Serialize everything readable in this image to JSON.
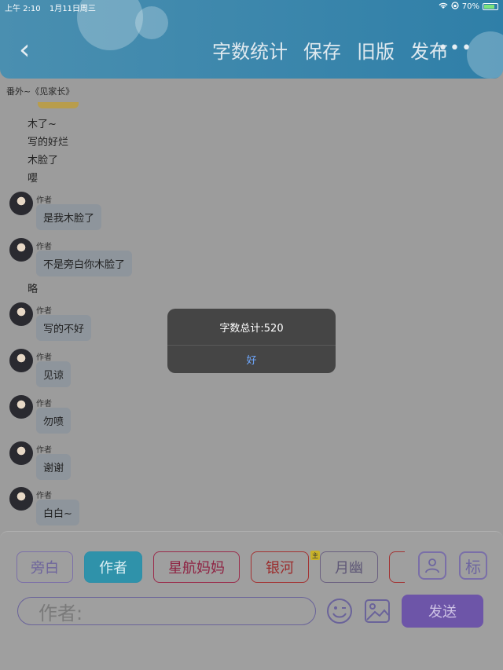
{
  "status": {
    "time": "上午 2:10",
    "date": "1月11日周三",
    "battery": "70%"
  },
  "header": {
    "back_icon": "chevron-left-icon",
    "nav": [
      "字数统计",
      "保存",
      "旧版",
      "发布"
    ],
    "more": "•••"
  },
  "subtitle": "番外~《见家长》",
  "plain_lines": [
    "木了~",
    "写的好烂",
    "木脸了",
    "嘤",
    "略"
  ],
  "messages": [
    {
      "name": "作者",
      "text": "是我木脸了"
    },
    {
      "name": "作者",
      "text": "不是旁白你木脸了"
    },
    {
      "name": "作者",
      "text": "写的不好"
    },
    {
      "name": "作者",
      "text": "见谅"
    },
    {
      "name": "作者",
      "text": "勿喷"
    },
    {
      "name": "作者",
      "text": "谢谢"
    },
    {
      "name": "作者",
      "text": "白白~"
    }
  ],
  "dialog": {
    "message": "字数总计:520",
    "ok": "好"
  },
  "roles": [
    "旁白",
    "作者",
    "星航妈妈",
    "银河",
    "月幽"
  ],
  "role_badge": "主",
  "tag_label": "标",
  "input": {
    "placeholder": "作者:"
  },
  "send_label": "发送",
  "colors": {
    "header": "#2f7fa8",
    "active_role": "#2f92aa",
    "send": "#6d55a8",
    "dialog_link": "#6ea8ff"
  }
}
